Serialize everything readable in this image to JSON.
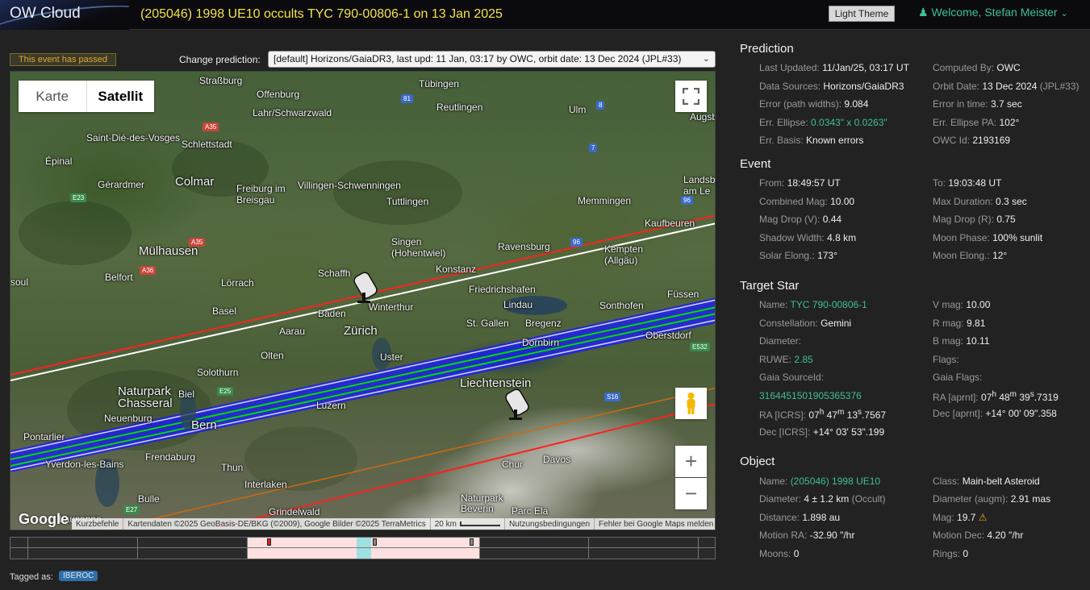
{
  "header": {
    "logo": "OW Cloud",
    "title": "(205046) 1998 UE10 occults TYC 790-00806-1 on 13 Jan 2025",
    "light_theme": "Light Theme",
    "welcome": "Welcome, Stefan Meister"
  },
  "controls": {
    "passed_badge": "This event has passed",
    "change_label": "Change prediction:",
    "prediction_selected": "[default] Horizons/GaiaDR3, last upd: 11 Jan, 03:17 by OWC, orbit date: 13 Dec 2024 (JPL#33)"
  },
  "map": {
    "map_type_options": [
      "Karte",
      "Satellit"
    ],
    "map_type_selected": "Satellit",
    "zoom_in": "+",
    "zoom_out": "−",
    "google": "Google",
    "attribution": [
      "Kurzbefehle",
      "Kartendaten ©2025 GeoBasis-DE/BKG (©2009), Google Bilder ©2025 TerraMetrics",
      "20 km",
      "Nutzungsbedingungen",
      "Fehler bei Google Maps melden"
    ],
    "places": [
      "Straßburg",
      "Tübingen",
      "Offenburg",
      "Reutlingen",
      "Lahr/Schwarzwald",
      "Saint-Dié-des-Vosges",
      "Schlettstadt",
      "Ulm",
      "Augsb",
      "Épinal",
      "Gérardmer",
      "Colmar",
      "Freiburg im Breisgau",
      "Villingen-Schwenningen",
      "Tuttlingen",
      "Memmingen",
      "Landsb am Le",
      "Kaufbeuren",
      "Mülhausen",
      "Singen (Hohentwiel)",
      "Ravensburg",
      "Kempten (Allgäu)",
      "soul",
      "Belfort",
      "Lörrach",
      "Schaffh",
      "Konstanz",
      "Friedrichshafen",
      "Basel",
      "Baden",
      "Winterthur",
      "Lindau",
      "Füssen",
      "Sonthofen",
      "Zürich",
      "St. Gallen",
      "Bregenz",
      "Aarau",
      "Olten",
      "Uster",
      "Dornbirn",
      "Oberstdorf",
      "Solothurn",
      "Liechtenstein",
      "Naturpark Chasseral",
      "Biel",
      "Luzern",
      "Neuenburg",
      "Bern",
      "Pontarlier",
      "Yverdon-les-Bains",
      "Frendaburg",
      "Thun",
      "Chur",
      "Davos",
      "Interlaken",
      "Bulle",
      "Lausanne",
      "Grindelwald",
      "Naturpark Beverin",
      "Parc Ela"
    ],
    "roads": [
      "A35",
      "81",
      "8",
      "7",
      "E23",
      "96",
      "A35",
      "A36",
      "96",
      "E532",
      "E25",
      "S16",
      "E27"
    ]
  },
  "tagged": {
    "label": "Tagged as:",
    "tags": [
      "IBEROC"
    ]
  },
  "prediction": {
    "title": "Prediction",
    "last_updated_label": "Last Updated:",
    "last_updated": "11/Jan/25, 03:17 UT",
    "computed_by_label": "Computed By:",
    "computed_by": "OWC",
    "data_sources_label": "Data Sources:",
    "data_sources": "Horizons/GaiaDR3",
    "orbit_date_label": "Orbit Date:",
    "orbit_date": "13 Dec 2024",
    "orbit_jpl": "(JPL#33)",
    "error_label": "Error (path widths):",
    "error": "9.084",
    "error_time_label": "Error in time:",
    "error_time": "3.7 sec",
    "err_ellipse_label": "Err. Ellipse:",
    "err_ellipse": "0.0343\" x 0.0263\"",
    "err_ellipse_pa_label": "Err. Ellipse PA:",
    "err_ellipse_pa": "102°",
    "err_basis_label": "Err. Basis:",
    "err_basis": "Known errors",
    "owc_id_label": "OWC Id:",
    "owc_id": "2193169"
  },
  "event": {
    "title": "Event",
    "from_label": "From:",
    "from": "18:49:57 UT",
    "to_label": "To:",
    "to": "19:03:48 UT",
    "combined_mag_label": "Combined Mag:",
    "combined_mag": "10.00",
    "max_duration_label": "Max Duration:",
    "max_duration": "0.3 sec",
    "mag_drop_v_label": "Mag Drop (V):",
    "mag_drop_v": "0.44",
    "mag_drop_r_label": "Mag Drop (R):",
    "mag_drop_r": "0.75",
    "shadow_width_label": "Shadow Width:",
    "shadow_width": "4.8 km",
    "moon_phase_label": "Moon Phase:",
    "moon_phase": "100% sunlit",
    "solar_elong_label": "Solar Elong.:",
    "solar_elong": "173°",
    "moon_elong_label": "Moon Elong.:",
    "moon_elong": "12°"
  },
  "target_star": {
    "title": "Target Star",
    "name_label": "Name:",
    "name": "TYC 790-00806-1",
    "vmag_label": "V mag:",
    "vmag": "10.00",
    "constellation_label": "Constellation:",
    "constellation": "Gemini",
    "rmag_label": "R mag:",
    "rmag": "9.81",
    "diameter_label": "Diameter:",
    "bmag_label": "B mag:",
    "bmag": "10.11",
    "ruwe_label": "RUWE:",
    "ruwe": "2.85",
    "flags_label": "Flags:",
    "gaia_source_label": "Gaia SourceId:",
    "gaia_source": "3164451501905365376",
    "gaia_flags_label": "Gaia Flags:",
    "ra_aprnt_label": "RA [aprnt]:",
    "ra_aprnt_h": "07",
    "ra_aprnt_m": "48",
    "ra_aprnt_s": "39",
    "ra_aprnt_f": ".7319",
    "ra_icrs_label": "RA [ICRS]:",
    "ra_icrs_h": "07",
    "ra_icrs_m": "47",
    "ra_icrs_s": "13",
    "ra_icrs_f": ".7567",
    "dec_aprnt_label": "Dec [aprnt]:",
    "dec_aprnt": "+14° 00' 09\".358",
    "dec_icrs_label": "Dec [ICRS]:",
    "dec_icrs": "+14° 03' 53\".199"
  },
  "object": {
    "title": "Object",
    "name_label": "Name:",
    "name": "(205046) 1998 UE10",
    "class_label": "Class:",
    "class": "Main-belt Asteroid",
    "diameter_label": "Diameter:",
    "diameter": "4 ± 1.2 km",
    "diameter_src": "(Occult)",
    "diameter_augm_label": "Diameter (augm):",
    "diameter_augm": "2.91 mas",
    "distance_label": "Distance:",
    "distance": "1.898 au",
    "mag_label": "Mag:",
    "mag": "19.7",
    "motion_ra_label": "Motion RA:",
    "motion_ra": "-32.90 \"/hr",
    "motion_dec_label": "Motion Dec:",
    "motion_dec": "4.20 \"/hr",
    "moons_label": "Moons:",
    "moons": "0",
    "rings_label": "Rings:",
    "rings": "0"
  },
  "colors": {
    "accent": "#3fbf9a",
    "title_yellow": "#f2e24b",
    "passed_orange": "#e8a42a",
    "path_center": "#00dd00",
    "path_shadow": "#1a1aff",
    "path_error": "#ff2020",
    "path_white": "#ffffff",
    "path_orange": "#cc6a10"
  },
  "icons": [
    "user-icon",
    "chevron-down-icon",
    "fullscreen-icon",
    "pegman-icon",
    "telescope-icon",
    "warning-icon"
  ]
}
